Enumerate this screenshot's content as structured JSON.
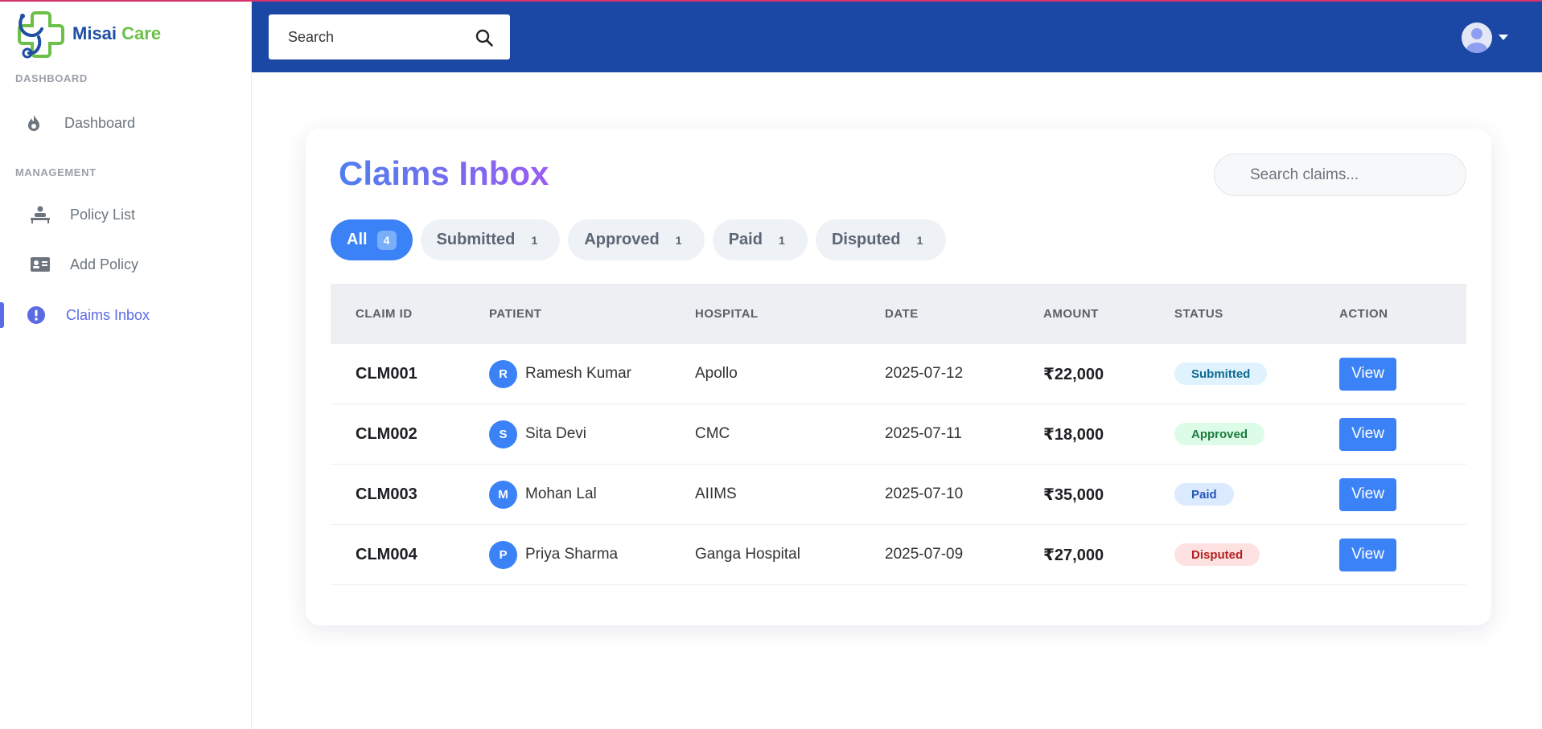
{
  "app": {
    "brand_part1": "Misai",
    "brand_part2": "Care",
    "accent_color": "#3b82f6",
    "header_color": "#1c48a5"
  },
  "sidebar": {
    "sections": [
      {
        "label": "DASHBOARD",
        "items": [
          {
            "label": "Dashboard",
            "icon": "flame-icon",
            "active": false
          }
        ]
      },
      {
        "label": "MANAGEMENT",
        "items": [
          {
            "label": "Policy List",
            "icon": "person-bed-icon",
            "active": false
          },
          {
            "label": "Add Policy",
            "icon": "id-card-icon",
            "active": false
          },
          {
            "label": "Claims Inbox",
            "icon": "exclamation-circle-icon",
            "active": true
          }
        ]
      }
    ]
  },
  "header": {
    "search_placeholder": "Search",
    "search_icon": "search-icon",
    "user_icon": "user-avatar-icon"
  },
  "main": {
    "title": "Claims Inbox",
    "search_placeholder": "Search claims...",
    "tabs": [
      {
        "label": "All",
        "count": "4",
        "active": true
      },
      {
        "label": "Submitted",
        "count": "1",
        "active": false
      },
      {
        "label": "Approved",
        "count": "1",
        "active": false
      },
      {
        "label": "Paid",
        "count": "1",
        "active": false
      },
      {
        "label": "Disputed",
        "count": "1",
        "active": false
      }
    ],
    "table": {
      "columns": [
        "CLAIM ID",
        "PATIENT",
        "HOSPITAL",
        "DATE",
        "AMOUNT",
        "STATUS",
        "ACTION"
      ],
      "rows": [
        {
          "claim_id": "CLM001",
          "initial": "R",
          "patient": "Ramesh Kumar",
          "hospital": "Apollo",
          "date": "2025-07-12",
          "amount": "₹22,000",
          "status": "Submitted",
          "action": "View"
        },
        {
          "claim_id": "CLM002",
          "initial": "S",
          "patient": "Sita Devi",
          "hospital": "CMC",
          "date": "2025-07-11",
          "amount": "₹18,000",
          "status": "Approved",
          "action": "View"
        },
        {
          "claim_id": "CLM003",
          "initial": "M",
          "patient": "Mohan Lal",
          "hospital": "AIIMS",
          "date": "2025-07-10",
          "amount": "₹35,000",
          "status": "Paid",
          "action": "View"
        },
        {
          "claim_id": "CLM004",
          "initial": "P",
          "patient": "Priya Sharma",
          "hospital": "Ganga Hospital",
          "date": "2025-07-09",
          "amount": "₹27,000",
          "status": "Disputed",
          "action": "View"
        }
      ]
    },
    "status_colors": {
      "Submitted": "#0e6a8f",
      "Approved": "#1a7a3e",
      "Paid": "#2456b8",
      "Disputed": "#b42020"
    }
  }
}
